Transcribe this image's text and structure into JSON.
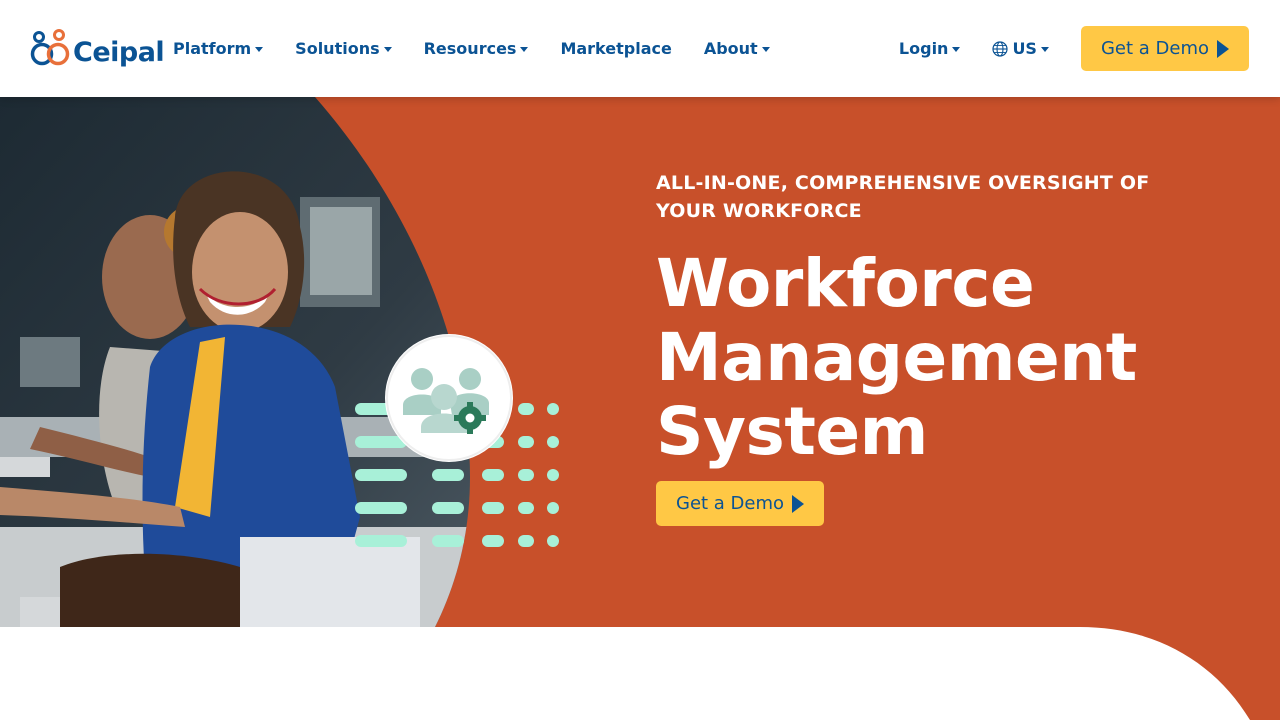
{
  "brand": {
    "name": "Ceipal"
  },
  "nav": {
    "items": [
      {
        "label": "Platform",
        "has_menu": true
      },
      {
        "label": "Solutions",
        "has_menu": true
      },
      {
        "label": "Resources",
        "has_menu": true
      },
      {
        "label": "Marketplace",
        "has_menu": false
      },
      {
        "label": "About",
        "has_menu": true
      }
    ],
    "login_label": "Login",
    "region_label": "US",
    "demo_label": "Get a Demo"
  },
  "hero": {
    "eyebrow": "ALL-IN-ONE, COMPREHENSIVE OVERSIGHT OF YOUR WORKFORCE",
    "title_lines": [
      "Workforce",
      "Management",
      "System"
    ],
    "cta_label": "Get a Demo"
  },
  "colors": {
    "brand_blue": "#0b5394",
    "brand_orange": "#e8703a",
    "hero_bg": "#c8502a",
    "cta_yellow": "#ffc845",
    "accent_mint": "#a8f0d8"
  },
  "icons": {
    "team_gear": "team-settings-icon",
    "globe": "globe-icon",
    "play": "play-icon"
  }
}
